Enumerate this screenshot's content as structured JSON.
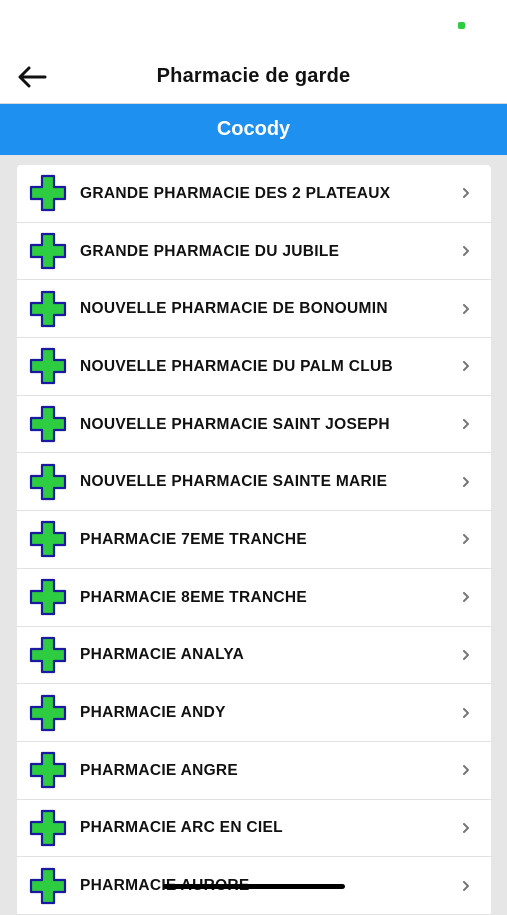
{
  "header": {
    "title": "Pharmacie de garde"
  },
  "commune": {
    "label": "Cocody"
  },
  "pharmacies": [
    {
      "name": "GRANDE PHARMACIE DES 2 PLATEAUX"
    },
    {
      "name": "GRANDE PHARMACIE DU JUBILE"
    },
    {
      "name": "NOUVELLE PHARMACIE DE BONOUMIN"
    },
    {
      "name": "NOUVELLE PHARMACIE DU PALM CLUB"
    },
    {
      "name": "NOUVELLE PHARMACIE SAINT JOSEPH"
    },
    {
      "name": "NOUVELLE PHARMACIE SAINTE MARIE"
    },
    {
      "name": "PHARMACIE 7EME TRANCHE"
    },
    {
      "name": "PHARMACIE 8EME TRANCHE"
    },
    {
      "name": "PHARMACIE ANALYA"
    },
    {
      "name": "PHARMACIE ANDY"
    },
    {
      "name": "PHARMACIE ANGRE"
    },
    {
      "name": "PHARMACIE ARC EN CIEL"
    },
    {
      "name": "PHARMACIE AURORE"
    }
  ],
  "icons": {
    "back": "arrow-left-icon",
    "item": "pharmacy-cross-icon",
    "chevron": "chevron-right-icon",
    "battery": "battery-icon"
  },
  "colors": {
    "accent": "#1e90f0",
    "cross_fill": "#2ecc40",
    "cross_outline": "#1a1aa0"
  }
}
